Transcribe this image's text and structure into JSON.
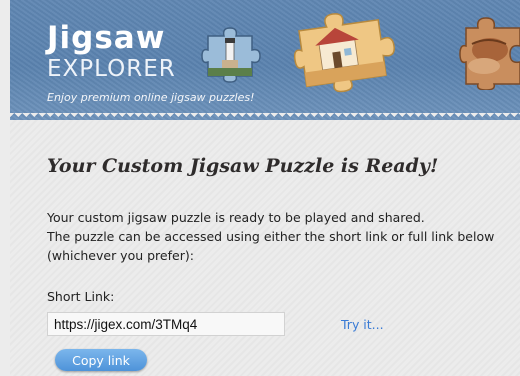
{
  "header": {
    "brand_line1": "Jigsaw",
    "brand_line2": "EXPLORER",
    "tagline": "Enjoy premium online jigsaw puzzles!",
    "icons": [
      "lighthouse-puzzle-piece-icon",
      "cottage-puzzle-piece-icon",
      "rock-puzzle-piece-icon"
    ]
  },
  "main": {
    "title": "Your Custom Jigsaw Puzzle is Ready!",
    "description": [
      "Your custom jigsaw puzzle is ready to be played and shared.",
      "The puzzle can be accessed using either the short link or full link below",
      "(whichever you prefer):"
    ],
    "short_link_label": "Short Link:",
    "short_link_value": "https://jigex.com/3TMq4",
    "try_it_label": "Try it...",
    "copy_button_label": "Copy link"
  },
  "colors": {
    "header_blue": "#5f86b2",
    "link_blue": "#3a7bd5",
    "button_blue": "#4e93d9"
  }
}
